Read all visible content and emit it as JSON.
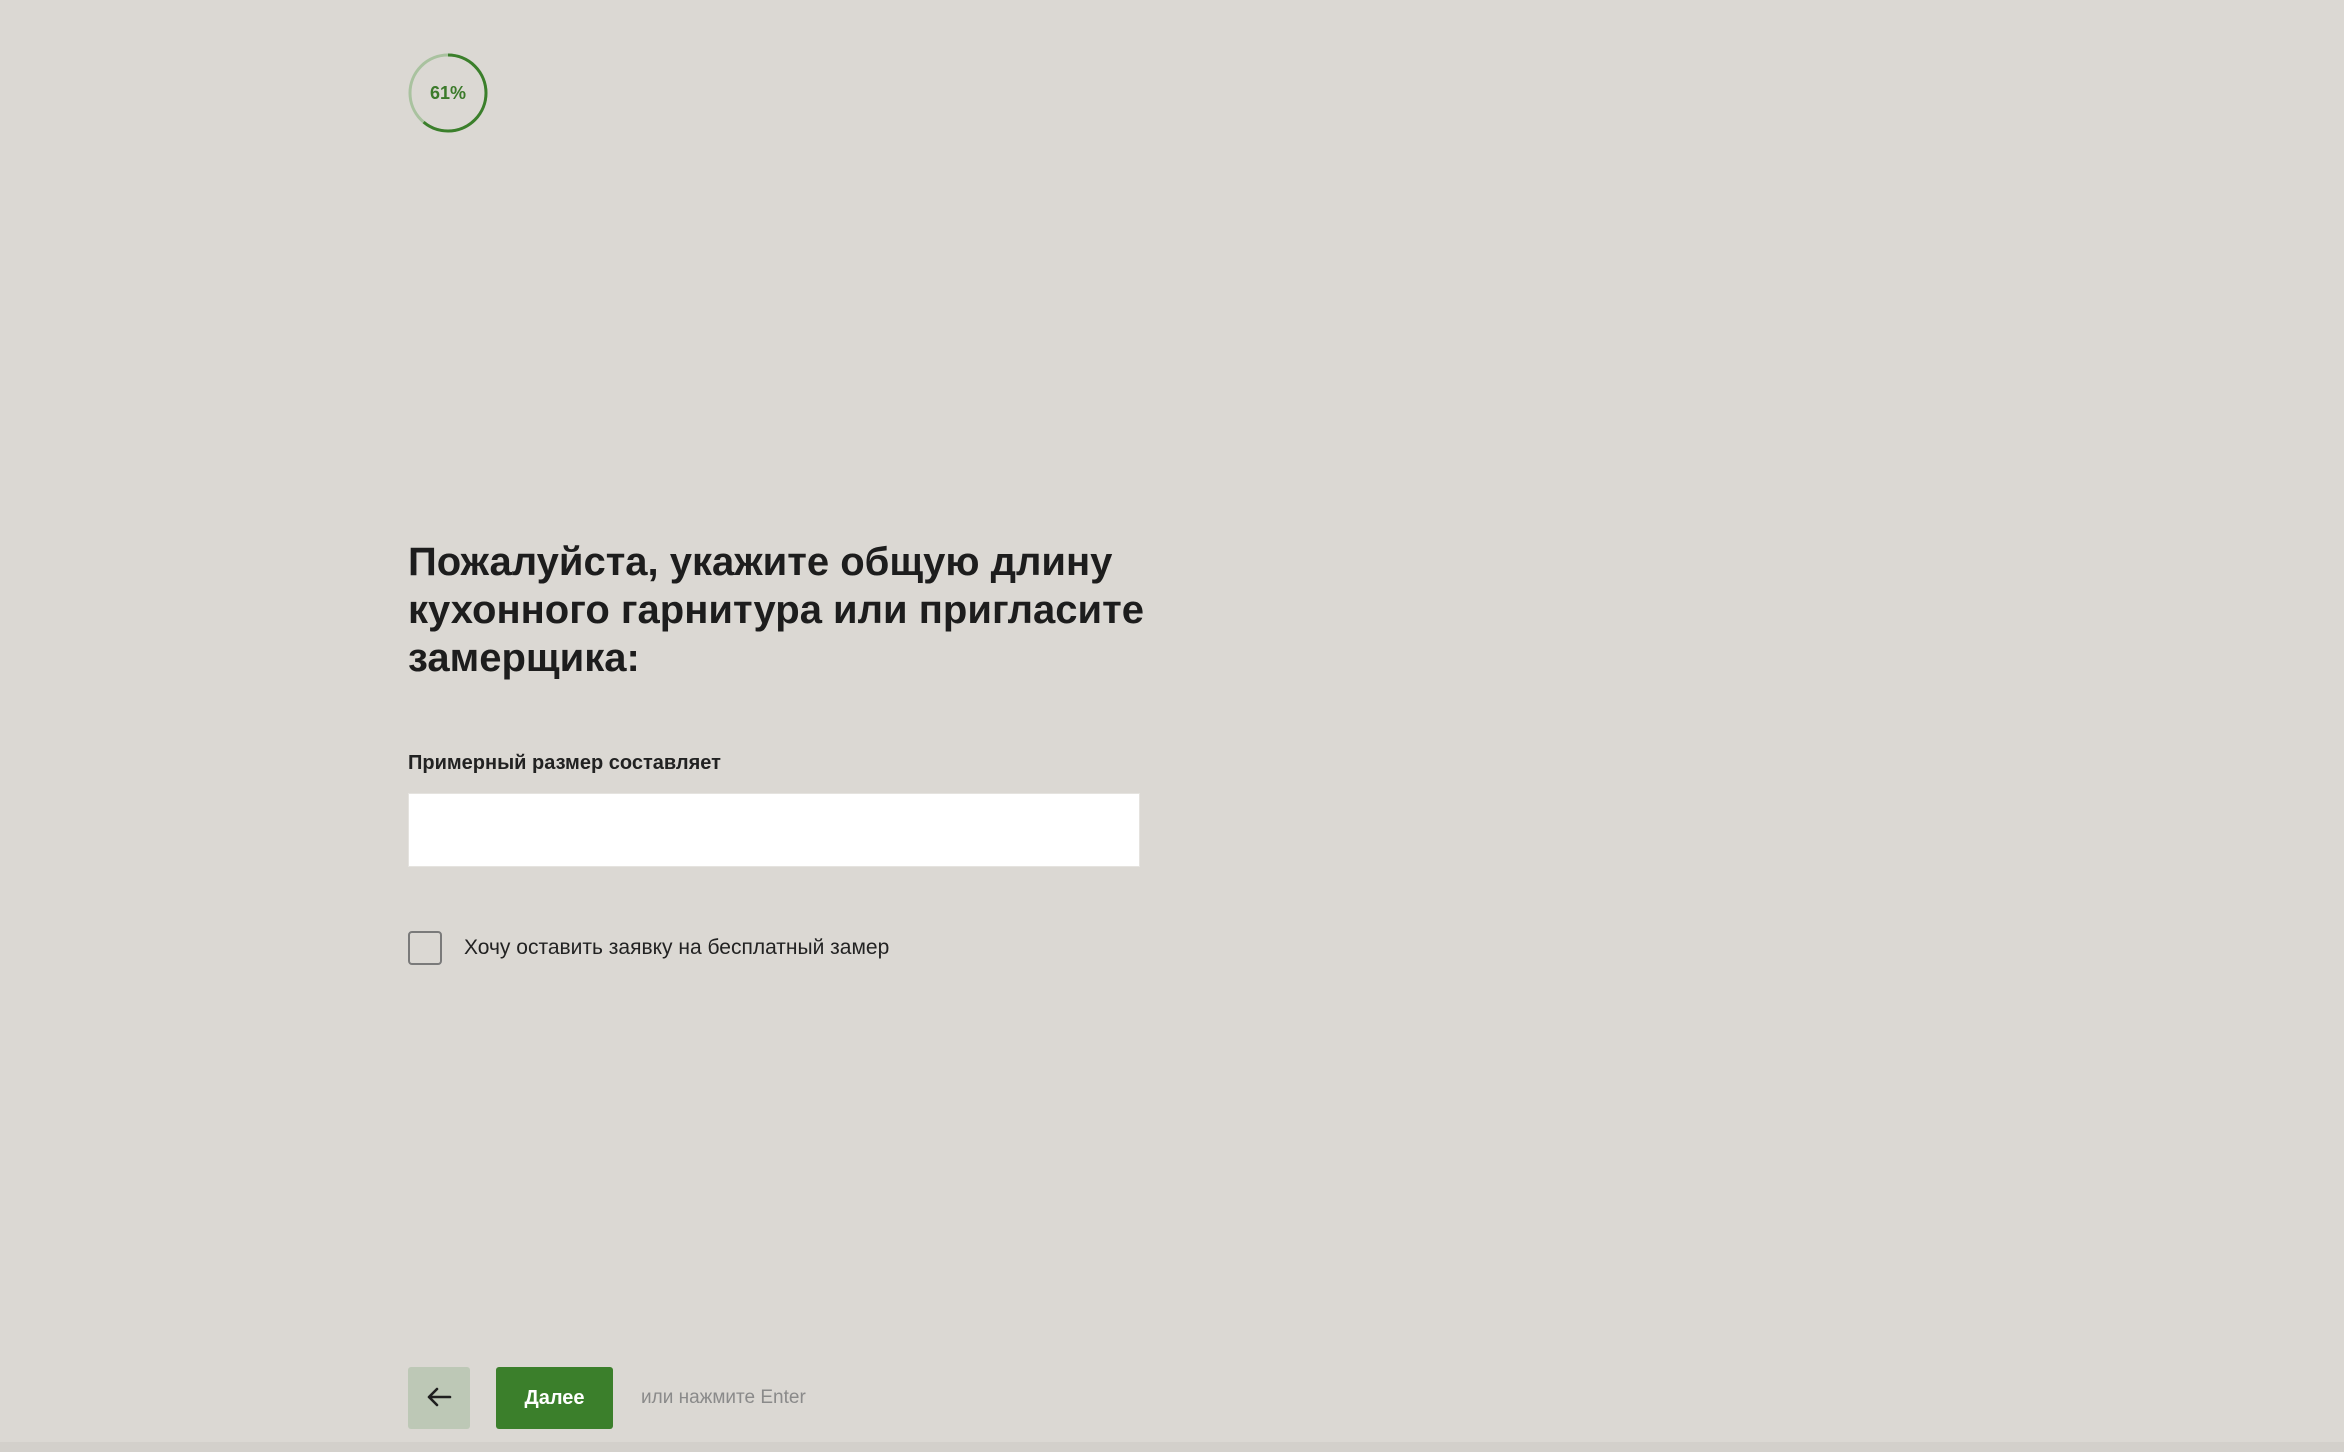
{
  "progress": {
    "value": 61,
    "label": "61%",
    "color_fill": "#3b7f2b",
    "color_track": "#a9c29f"
  },
  "question": {
    "title": "Пожалуйста, укажите общую длину кухонного гарнитура или пригласите замерщика:"
  },
  "size_field": {
    "label": "Примерный размер составляет",
    "value": "",
    "placeholder": ""
  },
  "free_measure": {
    "label": "Хочу оставить заявку на бесплатный замер",
    "checked": false
  },
  "nav": {
    "back_icon": "arrow-left-icon",
    "next_label": "Далее",
    "hint": "или нажмите Enter"
  },
  "colors": {
    "background": "#dbd8d3",
    "accent": "#3b7f2b",
    "back_button": "#bdc8b6"
  }
}
